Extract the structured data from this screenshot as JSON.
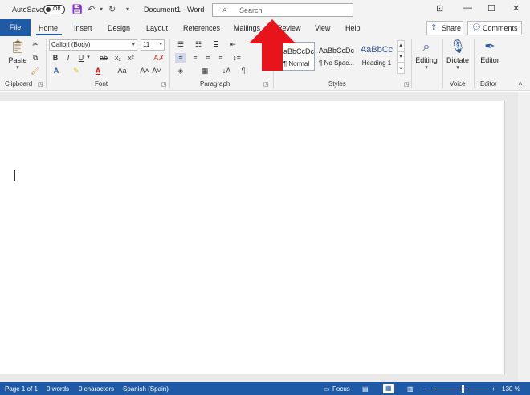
{
  "titlebar": {
    "autosave_label": "AutoSave",
    "autosave_state": "Off",
    "doc_title": "Document1  -  Word",
    "search_placeholder": "Search"
  },
  "tabs": {
    "file": "File",
    "items": [
      "Home",
      "Insert",
      "Design",
      "Layout",
      "References",
      "Mailings",
      "Review",
      "View",
      "Help"
    ],
    "share": "Share",
    "comments": "Comments"
  },
  "font": {
    "name": "Calibri (Body)",
    "size": "11"
  },
  "groups": {
    "clipboard": "Clipboard",
    "font": "Font",
    "paragraph": "Paragraph",
    "styles": "Styles",
    "voice": "Voice",
    "editor": "Editor"
  },
  "clipboard": {
    "paste": "Paste"
  },
  "styles": [
    {
      "sample": "AaBbCcDc",
      "name": "¶ Normal"
    },
    {
      "sample": "AaBbCcDc",
      "name": "¶ No Spac..."
    },
    {
      "sample": "AaBbCc",
      "name": "Heading 1"
    }
  ],
  "buttons": {
    "editing": "Editing",
    "dictate": "Dictate",
    "editor": "Editor"
  },
  "status": {
    "page": "Page 1 of 1",
    "words": "0 words",
    "characters": "0 characters",
    "language": "Spanish (Spain)",
    "focus": "Focus",
    "zoom": "130 %"
  },
  "colors": {
    "accent": "#1f5aa6",
    "arrow": "#e8141c"
  }
}
